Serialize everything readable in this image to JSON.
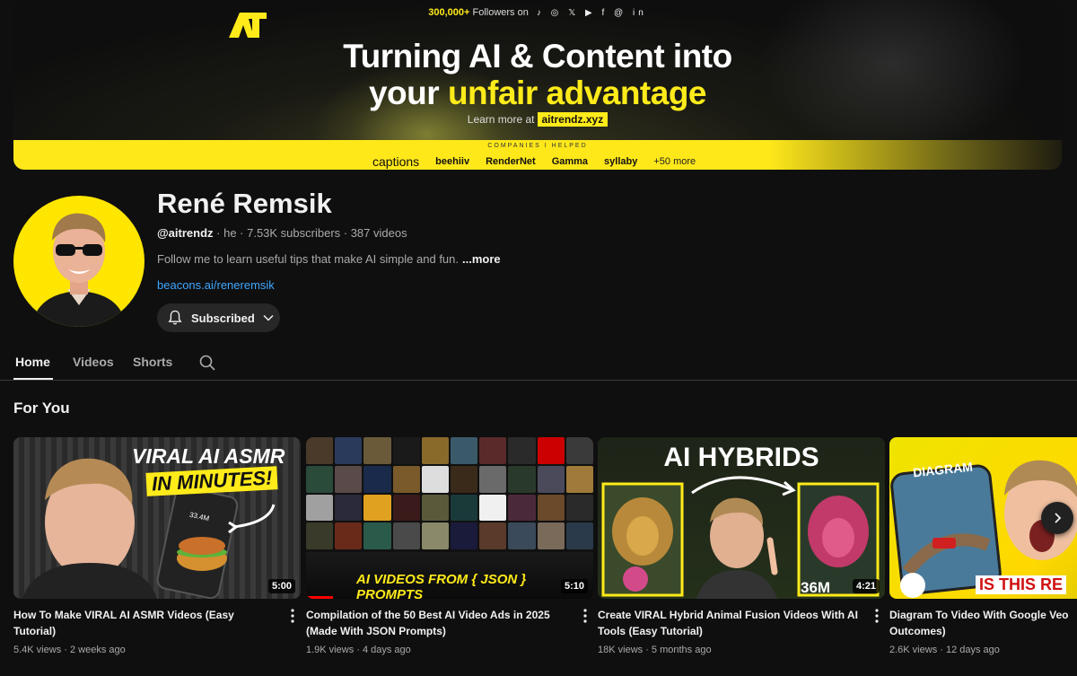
{
  "banner": {
    "followers_count": "300,000+",
    "followers_label": "Followers on",
    "socials": "♪ ◎ 𝕏 ▶ f @ in",
    "headline_line1": "Turning AI & Content into",
    "headline_line2_pre": "your ",
    "headline_line2_hl": "unfair advantage",
    "learn_more": "Learn more at",
    "learn_url": "aitrendz.xyz",
    "companies_helped": "COMPANIES I HELPED",
    "brands": [
      "captions",
      "beehiiv",
      "RenderNet",
      "Gamma",
      "syllaby",
      "+50 more"
    ]
  },
  "channel": {
    "name": "René Remsik",
    "handle": "@aitrendz",
    "meta_rest": " · he · 7.53K subscribers · 387 videos",
    "description": "Follow me to learn useful tips that make AI simple and fun.",
    "more_label": "...more",
    "link": "beacons.ai/reneremsik",
    "subscribed_label": "Subscribed"
  },
  "tabs": [
    {
      "label": "Home"
    },
    {
      "label": "Videos"
    },
    {
      "label": "Shorts"
    }
  ],
  "section_title": "For You",
  "videos": [
    {
      "thumb_text1": "VIRAL AI ASMR",
      "thumb_text2": "IN MINUTES!",
      "thumb_badge": "33.4M",
      "duration": "5:00",
      "title": "How To Make VIRAL AI ASMR Videos (Easy Tutorial)",
      "meta": "5.4K views · 2 weeks ago"
    },
    {
      "thumb_text1": "AI VIDEOS FROM { JSON } PROMPTS",
      "duration": "5:10",
      "title": "Compilation of the 50 Best AI Video Ads in 2025 (Made With JSON Prompts)",
      "meta": "1.9K views · 4 days ago"
    },
    {
      "thumb_text1": "AI HYBRIDS",
      "thumb_badge": "36M",
      "duration": "4:21",
      "title": "Create VIRAL Hybrid Animal Fusion Videos With AI Tools (Easy Tutorial)",
      "meta": "18K views · 5 months ago"
    },
    {
      "thumb_text1": "DIAGRAM",
      "thumb_text2": "IS THIS RE",
      "title": "Diagram To Video With Google Veo Outcomes)",
      "meta": "2.6K views · 12 days ago"
    }
  ],
  "colors": {
    "background": "#0f0f0f",
    "accent_yellow": "#ffeb1a",
    "link_blue": "#3ea6ff",
    "text_secondary": "#aaaaaa"
  }
}
